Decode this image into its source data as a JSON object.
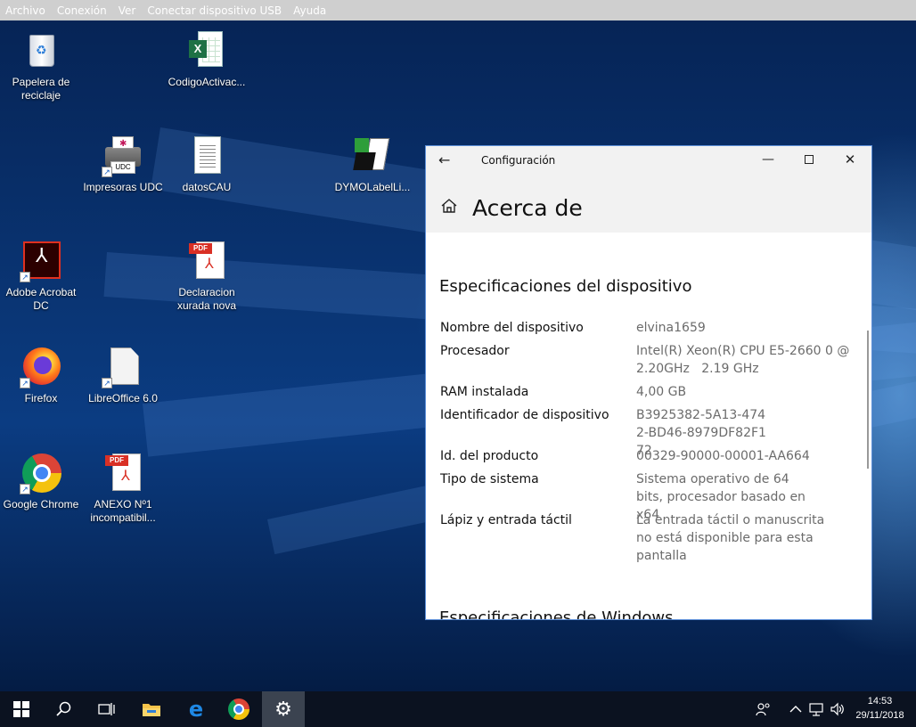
{
  "menubar": {
    "items": [
      "Archivo",
      "Conexión",
      "Ver",
      "Conectar dispositivo USB",
      "Ayuda"
    ]
  },
  "desktop": {
    "icons": [
      {
        "label": "Papelera de reciclaje",
        "icon": "recycle-bin-icon"
      },
      {
        "label": "CodigoActivac...",
        "icon": "excel-file-icon"
      },
      {
        "label": "Impresoras UDC",
        "icon": "printer-icon",
        "badge": "UDC"
      },
      {
        "label": "datosCAU",
        "icon": "text-file-icon"
      },
      {
        "label": "DYMOLabelLi...",
        "icon": "dymo-icon"
      },
      {
        "label": "Adobe Acrobat DC",
        "icon": "acrobat-icon"
      },
      {
        "label": "Declaracion xurada nova",
        "icon": "pdf-file-icon",
        "badge": "PDF"
      },
      {
        "label": "Firefox",
        "icon": "firefox-icon"
      },
      {
        "label": "LibreOffice 6.0",
        "icon": "libreoffice-icon"
      },
      {
        "label": "Google Chrome",
        "icon": "chrome-icon"
      },
      {
        "label": "ANEXO Nº1 incompatibil...",
        "icon": "pdf-file-icon",
        "badge": "PDF"
      }
    ]
  },
  "window": {
    "title": "Configuración",
    "page_title": "Acerca de",
    "section_title": "Especificaciones del dispositivo",
    "next_section_title": "Especificaciones de Windows",
    "specs": [
      {
        "label": "Nombre del dispositivo",
        "value": "elvina1659"
      },
      {
        "label": "Procesador",
        "value": "Intel(R) Xeon(R) CPU E5-2660 0 @ 2.20GHz   2.19 GHz"
      },
      {
        "label": "RAM instalada",
        "value": "4,00 GB"
      },
      {
        "label": "Identificador de dispositivo",
        "value": "B3925382-5A13-4742-BD46-8979DF82F172"
      },
      {
        "label": "Id. del producto",
        "value": "00329-90000-00001-AA664"
      },
      {
        "label": "Tipo de sistema",
        "value": "Sistema operativo de 64 bits, procesador basado en x64"
      },
      {
        "label": "Lápiz y entrada táctil",
        "value": "La entrada táctil o manuscrita no está disponible para esta pantalla"
      }
    ]
  },
  "taskbar": {
    "items": [
      "start-icon",
      "search-icon",
      "task-view-icon",
      "file-explorer-icon",
      "edge-icon",
      "chrome-icon",
      "settings-icon"
    ],
    "active": "settings-icon",
    "time": "14:53",
    "date": "29/11/2018"
  },
  "colors": {
    "menubar_bg": "#cfcfcf",
    "window_header_bg": "#f2f2f2",
    "taskbar_bg": "#0b1220",
    "spec_value": "#6b6b6b"
  }
}
